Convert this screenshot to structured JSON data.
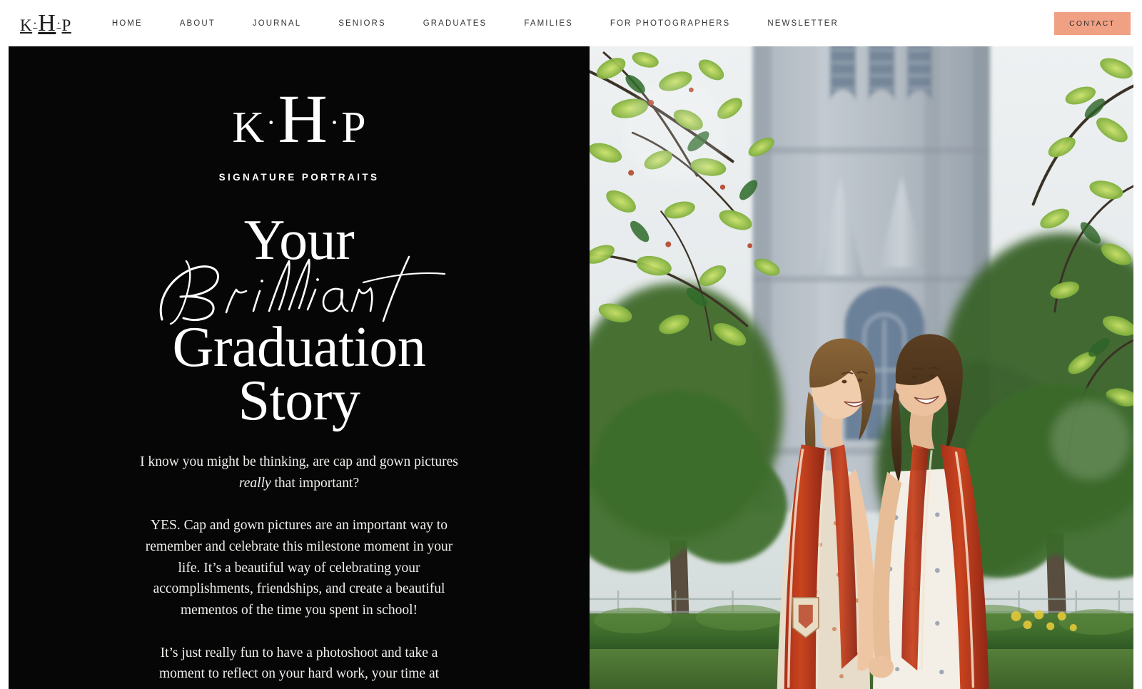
{
  "nav": {
    "logo": {
      "left": "K",
      "dot": "·",
      "mid": "H",
      "right": "P"
    },
    "items": [
      {
        "label": "HOME"
      },
      {
        "label": "ABOUT"
      },
      {
        "label": "JOURNAL"
      },
      {
        "label": "SENIORS"
      },
      {
        "label": "GRADUATES"
      },
      {
        "label": "FAMILIES"
      },
      {
        "label": "FOR PHOTOGRAPHERS"
      },
      {
        "label": "NEWSLETTER"
      }
    ],
    "contact_label": "CONTACT",
    "contact_color": "#f0a183"
  },
  "hero": {
    "logo": {
      "left": "K",
      "dot": "·",
      "mid": "H",
      "right": "P"
    },
    "tagline": "SIGNATURE PORTRAITS",
    "headline": {
      "line1": "Your",
      "script": "Brilliant",
      "line2": "Graduation",
      "line3": "Story"
    },
    "paragraphs": [
      {
        "part1": "I know you might be thinking, are cap and gown pictures ",
        "emphasis": "really",
        "part2": " that important?"
      },
      {
        "text": "YES. Cap and gown pictures are an important way to remember and celebrate this milestone moment in your life. It’s a beautiful way of celebrating your accomplishments, friendships, and create a beautiful mementos of the time you spent in school!"
      },
      {
        "text": "It’s just really fun to have a photoshoot and take a moment to reflect on your hard work, your time at"
      }
    ],
    "background_color": "#060606",
    "text_color": "#ffffff",
    "photo_alt": "Two graduates in red stoles laughing back-to-back in front of a gothic stone tower"
  }
}
